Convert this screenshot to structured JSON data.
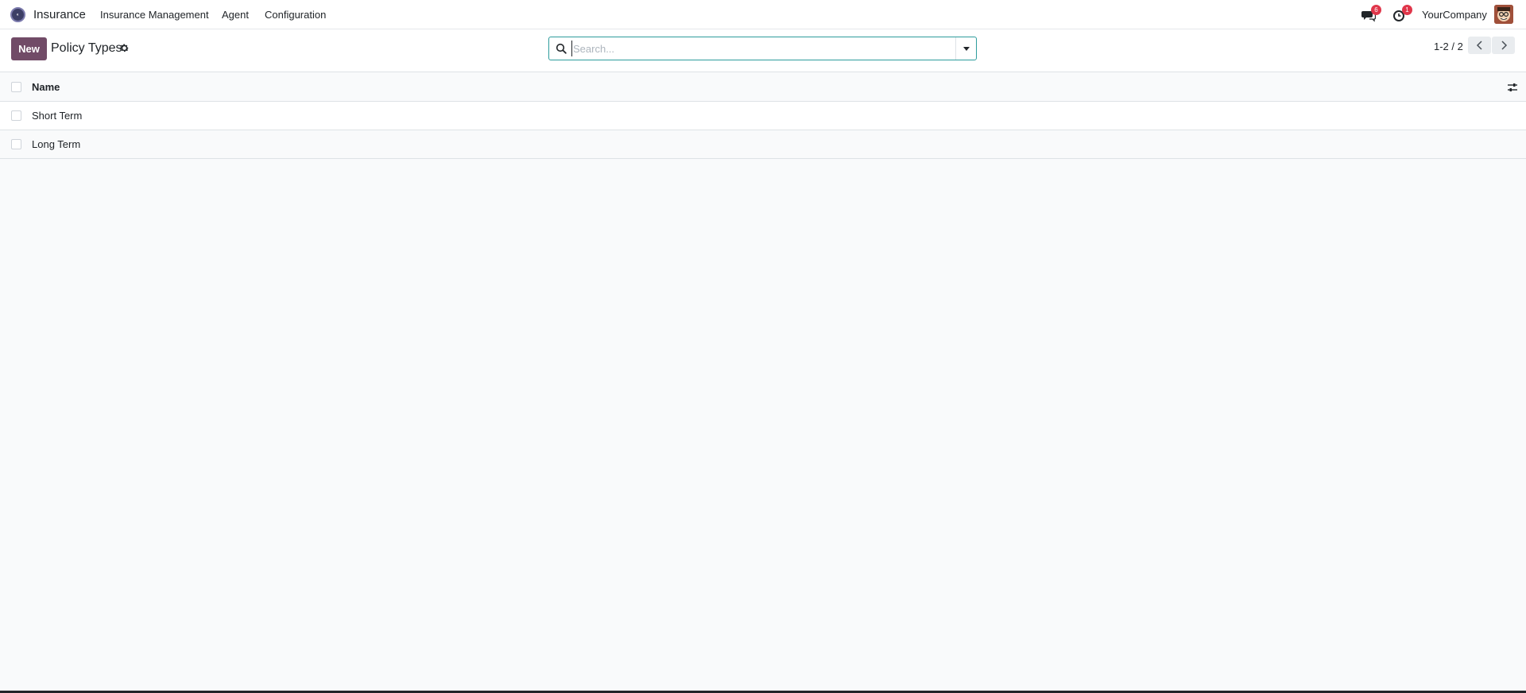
{
  "navbar": {
    "app_name": "Insurance",
    "menu": [
      {
        "label": "Insurance Management"
      },
      {
        "label": "Agent"
      },
      {
        "label": "Configuration"
      }
    ],
    "messages_count": "6",
    "activities_count": "1",
    "company": "YourCompany"
  },
  "control_panel": {
    "new_label": "New",
    "title": "Policy Types",
    "search_placeholder": "Search...",
    "pager": "1-2 / 2"
  },
  "list": {
    "columns": [
      {
        "label": "Name"
      }
    ],
    "rows": [
      {
        "name": "Short Term"
      },
      {
        "name": "Long Term"
      }
    ]
  },
  "colors": {
    "brand": "#714b67",
    "badge": "#e0364a",
    "search_border": "#2d9c9c"
  },
  "icons": [
    "app-logo-icon",
    "messages-icon",
    "activity-clock-icon",
    "gear-icon",
    "search-icon",
    "chevron-left-icon",
    "chevron-right-icon",
    "optional-columns-icon"
  ]
}
